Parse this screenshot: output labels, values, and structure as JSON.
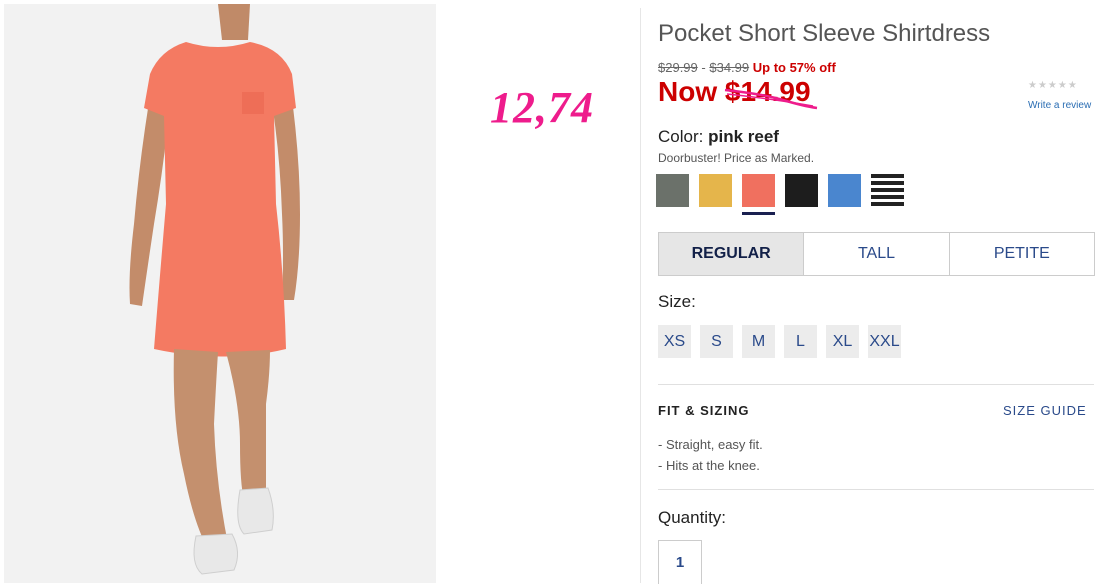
{
  "product": {
    "title": "Pocket Short Sleeve Shirtdress",
    "original_price_1": "$29.99",
    "separator": "-",
    "original_price_2": "$34.99",
    "discount": "Up to 57% off",
    "now_label": "Now",
    "now_price": "$14.99",
    "handwritten_price": "12,74",
    "rating_stars": "★★★★★",
    "review_link": "Write a review"
  },
  "color": {
    "label": "Color:",
    "selected": "pink reef",
    "note": "Doorbuster! Price as Marked.",
    "swatches": [
      {
        "name": "green-gray",
        "hex": "#6b716a"
      },
      {
        "name": "yellow",
        "hex": "#e5b54b"
      },
      {
        "name": "pink reef",
        "hex": "#f0705f"
      },
      {
        "name": "black",
        "hex": "#1d1d1d"
      },
      {
        "name": "blue",
        "hex": "#4a86cf"
      },
      {
        "name": "stripe",
        "hex": "#222222"
      }
    ],
    "selected_index": 2
  },
  "fit_tabs": [
    "REGULAR",
    "TALL",
    "PETITE"
  ],
  "fit_active": "REGULAR",
  "size": {
    "label": "Size:",
    "options": [
      "XS",
      "S",
      "M",
      "L",
      "XL",
      "XXL"
    ]
  },
  "fit_sizing": {
    "heading": "FIT & SIZING",
    "guide_link": "SIZE GUIDE",
    "bullets": [
      "- Straight, easy fit.",
      "- Hits at the knee."
    ]
  },
  "quantity": {
    "label": "Quantity:",
    "value": "1"
  },
  "colors": {
    "accent_red": "#cc0000",
    "link_blue": "#2a4a8a",
    "marker_pink": "#ee1c8c",
    "dress": "#f47a62"
  }
}
